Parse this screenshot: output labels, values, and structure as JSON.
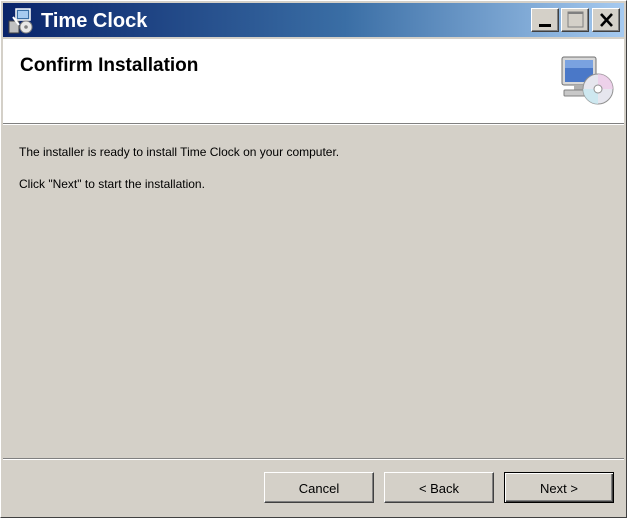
{
  "window": {
    "title": "Time Clock",
    "controls": {
      "minimize": "minimize-icon",
      "maximize": "maximize-icon",
      "close": "close-icon"
    }
  },
  "header": {
    "title": "Confirm Installation",
    "icon": "computer-cd-icon"
  },
  "body": {
    "line1": "The installer is ready to install Time Clock on your computer.",
    "line2": "Click \"Next\" to start the installation."
  },
  "buttons": {
    "cancel": "Cancel",
    "back": "< Back",
    "next": "Next >"
  },
  "colors": {
    "titlebar_start": "#0a246a",
    "titlebar_end": "#a6caf0",
    "dialog_bg": "#d4d0c8",
    "header_bg": "#ffffff"
  }
}
